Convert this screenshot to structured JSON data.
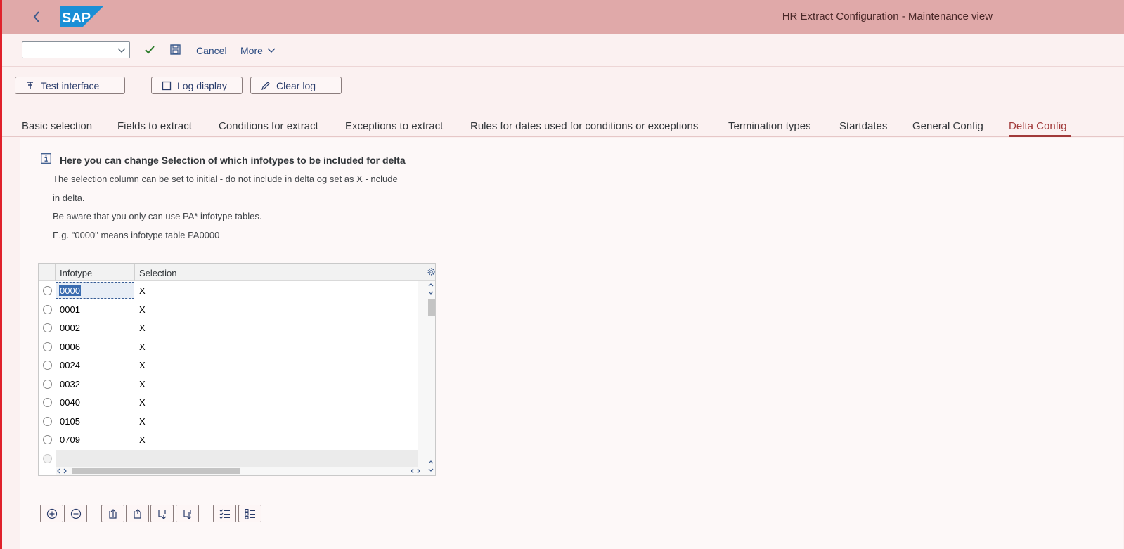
{
  "shell": {
    "title": "HR Extract Configuration - Maintenance view",
    "logo_text": "SAP"
  },
  "toolbar": {
    "ok_code_value": "",
    "cancel_label": "Cancel",
    "more_label": "More"
  },
  "actions": {
    "test_interface": "Test interface",
    "log_display": "Log display",
    "clear_log": "Clear log"
  },
  "tabs": [
    {
      "label": "Basic selection"
    },
    {
      "label": "Fields to extract"
    },
    {
      "label": "Conditions for extract"
    },
    {
      "label": "Exceptions to extract"
    },
    {
      "label": "Rules for dates used for conditions or exceptions"
    },
    {
      "label": "Termination types"
    },
    {
      "label": "Startdates"
    },
    {
      "label": "General Config"
    },
    {
      "label": "Delta Config"
    }
  ],
  "active_tab": "Delta Config",
  "info": {
    "title": "Here you can change Selection of which infotypes to be included for delta",
    "lines": [
      "The selection column can be set to initial - do not include in delta og set as X - nclude",
      "in delta.",
      "Be aware that you only can use PA* infotype tables.",
      "E.g. \"0000\" means infotype table PA0000"
    ]
  },
  "table": {
    "columns": [
      "Infotype",
      "Selection"
    ],
    "rows": [
      {
        "infotype": "0000",
        "selection": "X"
      },
      {
        "infotype": "0001",
        "selection": "X"
      },
      {
        "infotype": "0002",
        "selection": "X"
      },
      {
        "infotype": "0006",
        "selection": "X"
      },
      {
        "infotype": "0024",
        "selection": "X"
      },
      {
        "infotype": "0032",
        "selection": "X"
      },
      {
        "infotype": "0040",
        "selection": "X"
      },
      {
        "infotype": "0105",
        "selection": "X"
      },
      {
        "infotype": "0709",
        "selection": "X"
      }
    ]
  },
  "colors": {
    "shell_bg": "#e0a9a9",
    "page_bg": "#fbf1f1",
    "accent": "#a13a3a",
    "link": "#2a4a80"
  }
}
